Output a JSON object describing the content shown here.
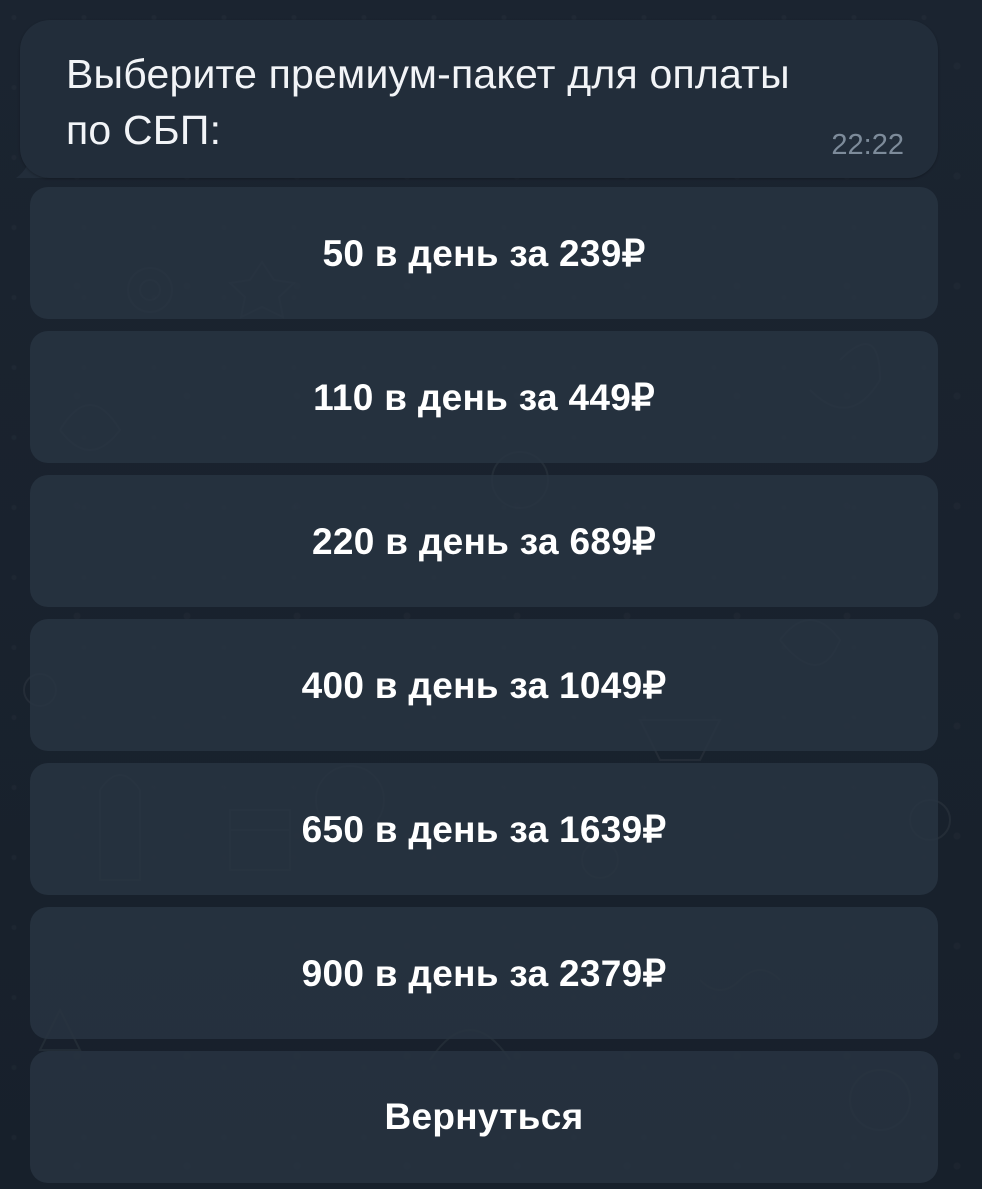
{
  "message": {
    "text_line1": "Выберите премиум-пакет для оплаты",
    "text_line2": "по СБП:",
    "time": "22:22"
  },
  "keyboard": {
    "buttons": [
      {
        "label": "50 в день за 239₽"
      },
      {
        "label": "110 в день за 449₽"
      },
      {
        "label": "220 в день за 689₽"
      },
      {
        "label": "400 в день за 1049₽"
      },
      {
        "label": "650 в день за 1639₽"
      },
      {
        "label": "900 в день за 2379₽"
      },
      {
        "label": "Вернуться"
      }
    ]
  },
  "colors": {
    "background": "#19212c",
    "bubble": "#222d3a",
    "button": "#283442",
    "text": "#ffffff",
    "time": "#7d8b9a"
  }
}
